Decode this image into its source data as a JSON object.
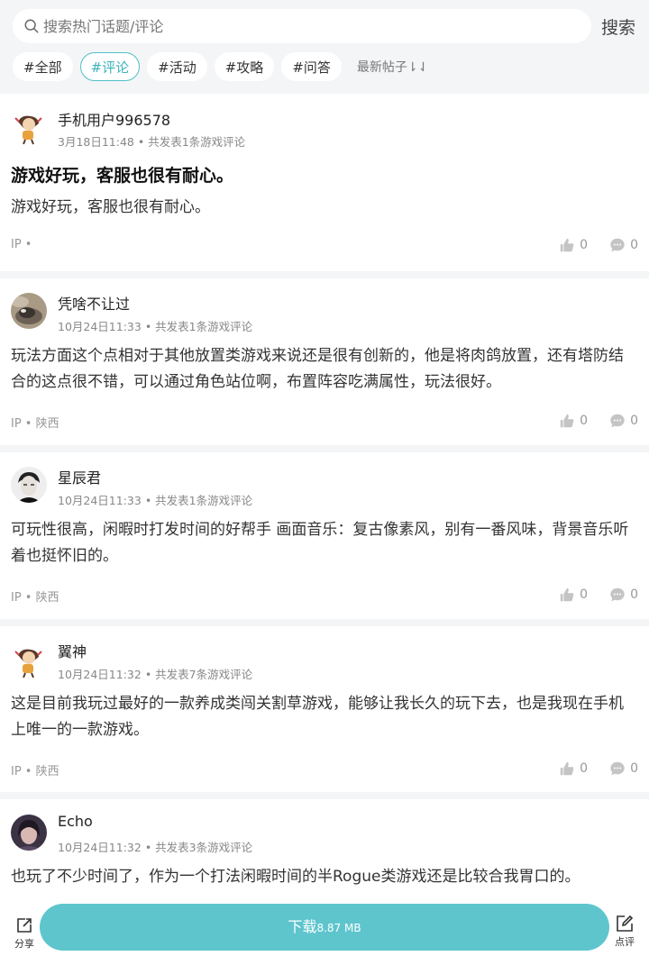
{
  "search": {
    "placeholder": "搜索热门话题/评论",
    "button": "搜索"
  },
  "tags": [
    "#全部",
    "#评论",
    "#活动",
    "#攻略",
    "#问答"
  ],
  "active_tag_index": 1,
  "sort_label": "最新帖子⇂⇃",
  "posts": [
    {
      "user": "手机用户996578",
      "date": "3月18日11:48",
      "summary": "共发表1条游戏评论",
      "title": "游戏好玩，客服也很有耐心。",
      "body": "游戏好玩，客服也很有耐心。",
      "ip": "IP •",
      "likes": "0",
      "comments": "0",
      "avatar": "cartoon-avatar"
    },
    {
      "user": "凭啥不让过",
      "date": "10月24日11:33",
      "summary": "共发表1条游戏评论",
      "title": "",
      "body": "玩法方面这个点相对于其他放置类游戏来说还是很有创新的，他是将肉鸽放置，还有塔防结合的这点很不错，可以通过角色站位啊，布置阵容吃满属性，玩法很好。",
      "ip": "IP • 陕西",
      "likes": "0",
      "comments": "0",
      "avatar": "photo-avatar"
    },
    {
      "user": "星辰君",
      "date": "10月24日11:33",
      "summary": "共发表1条游戏评论",
      "title": "",
      "body": "可玩性很高，闲暇时打发时间的好帮手 画面音乐：复古像素风，别有一番风味，背景音乐听着也挺怀旧的。",
      "ip": "IP • 陕西",
      "likes": "0",
      "comments": "0",
      "avatar": "photo-avatar"
    },
    {
      "user": "翼神",
      "date": "10月24日11:32",
      "summary": "共发表7条游戏评论",
      "title": "",
      "body": "这是目前我玩过最好的一款养成类闯关割草游戏，能够让我长久的玩下去，也是我现在手机上唯一的一款游戏。",
      "ip": "IP • 陕西",
      "likes": "0",
      "comments": "0",
      "avatar": "cartoon-avatar"
    },
    {
      "user": "Echo",
      "date": "10月24日11:32",
      "summary": "共发表3条游戏评论",
      "title": "",
      "body": "也玩了不少时间了，作为一个打法闲暇时间的半Rogue类游戏还是比较合我胃口的。",
      "ip": "",
      "likes": "",
      "comments": "",
      "avatar": "photo-avatar"
    }
  ],
  "bottom": {
    "share": "分享",
    "download": "下载",
    "size": "8.87 MB",
    "review": "点评"
  },
  "colors": {
    "accent": "#5ec5cd",
    "tag_active": "#4fc1c8",
    "background": "#f4f5f7"
  }
}
